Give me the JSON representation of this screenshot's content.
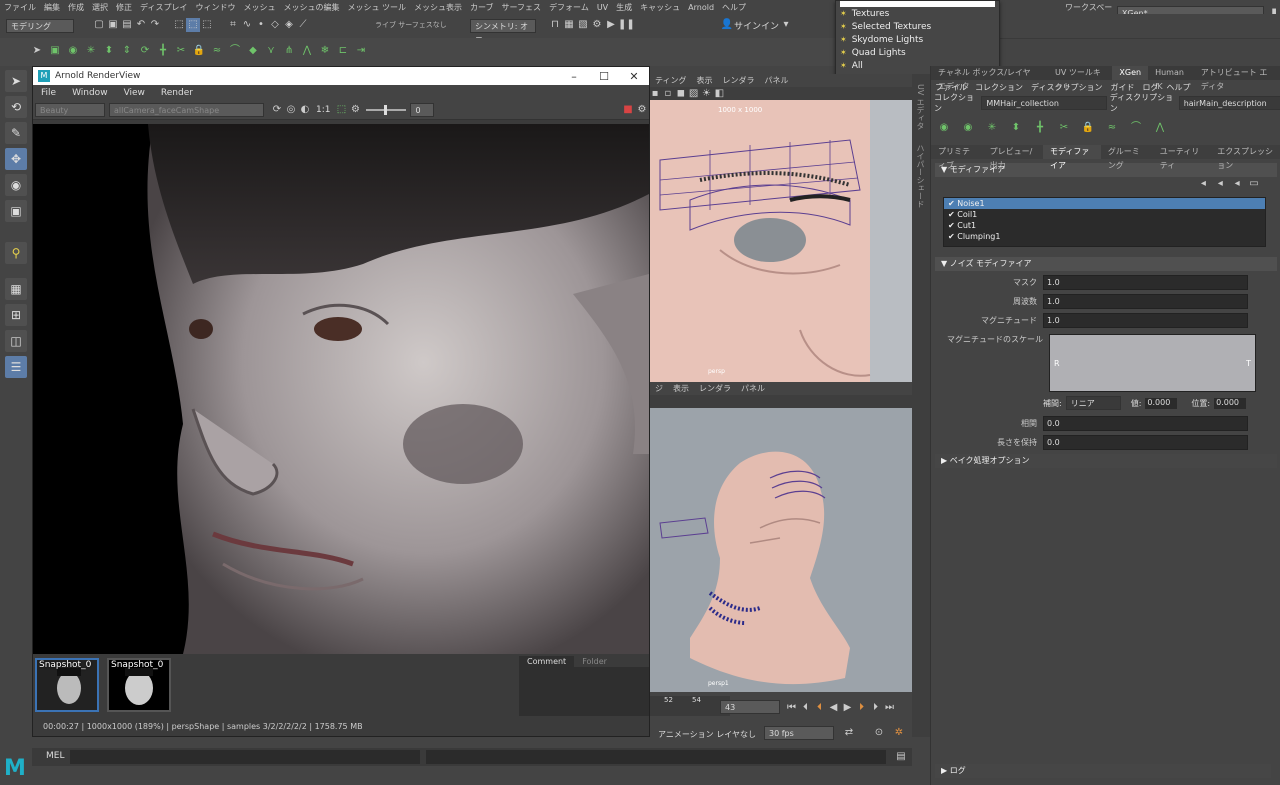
{
  "menubar": [
    "ファイル",
    "編集",
    "作成",
    "選択",
    "修正",
    "ディスプレイ",
    "ウィンドウ",
    "メッシュ",
    "メッシュの編集",
    "メッシュ ツール",
    "メッシュ表示",
    "カーブ",
    "サーフェス",
    "デフォーム",
    "UV",
    "生成",
    "キャッシュ",
    "Arnold",
    "ヘルプ"
  ],
  "toolbar": {
    "mode": "モデリング",
    "live_surface": "ライブ サーフェスなし",
    "symmetry": "シンメトリ: オフ",
    "signin": "サインイン",
    "workspace_label": "ワークスペース:",
    "workspace": "XGen*"
  },
  "popup": {
    "items": [
      "Textures",
      "Selected Textures",
      "Skydome Lights",
      "Quad Lights",
      "All"
    ]
  },
  "arnold": {
    "title": "Arnold RenderView",
    "menu": [
      "File",
      "Window",
      "View",
      "Render"
    ],
    "aov": "Beauty",
    "camera": "allCamera_faceCamShape",
    "ratio": "1:1",
    "exposure": "0",
    "snapshots": [
      "Snapshot_0",
      "Snapshot_0"
    ],
    "tabs": [
      "Comment",
      "Folder"
    ],
    "status": "00:00:27 | 1000x1000 (189%) | perspShape | samples 3/2/2/2/2/2 | 1758.75 MB"
  },
  "viewport_top": {
    "menu": [
      "ティング",
      "表示",
      "レンダラ",
      "パネル"
    ],
    "resolution": "1000 x 1000",
    "camera": "persp"
  },
  "viewport_bottom": {
    "menu": [
      "ジ",
      "表示",
      "レンダラ",
      "パネル"
    ],
    "camera": "persp1"
  },
  "timeline": {
    "ticks": [
      "52",
      "54"
    ],
    "frame": "43",
    "anim_layer": "アニメーション レイヤなし",
    "fps": "30 fps"
  },
  "cmd": {
    "label": "MEL"
  },
  "rightpanel": {
    "tabs": [
      "チャネル ボックス/レイヤ エディタ",
      "UV ツールキット",
      "XGen",
      "Human IK",
      "アトリビュート エディタ"
    ],
    "menu": [
      "ファイル",
      "コレクション",
      "ディスクリプション",
      "ガイド",
      "ログ",
      "ヘルプ"
    ],
    "collection_label": "コレクション",
    "collection": "MMHair_collection",
    "description_label": "ディスクリプション",
    "description": "hairMain_description",
    "subtabs": [
      "プリミティブ",
      "プレビュー/出力",
      "モディファイア",
      "グルーミング",
      "ユーティリティ",
      "エクスプレッション"
    ],
    "modifier_section": "モディファイア",
    "modifiers": [
      "Noise1",
      "Coil1",
      "Cut1",
      "Clumping1"
    ],
    "noise_section": "ノイズ モディファイア",
    "fields": [
      {
        "label": "マスク",
        "value": "1.0"
      },
      {
        "label": "周波数",
        "value": "1.0"
      },
      {
        "label": "マグニチュード",
        "value": "1.0"
      }
    ],
    "scale_label": "マグニチュードのスケール",
    "ramp_r": "R",
    "ramp_t": "T",
    "interp_label": "補間:",
    "interp": "リニア",
    "value_label": "値:",
    "value": "0.000",
    "pos_label": "位置:",
    "pos": "0.000",
    "fields2": [
      {
        "label": "相関",
        "value": "0.0"
      },
      {
        "label": "長さを保持",
        "value": "0.0"
      }
    ],
    "bake_section": "ベイク処理オプション",
    "log": "ログ"
  },
  "side_tabs": [
    "UV エディタ",
    "ハイパーシェード"
  ]
}
